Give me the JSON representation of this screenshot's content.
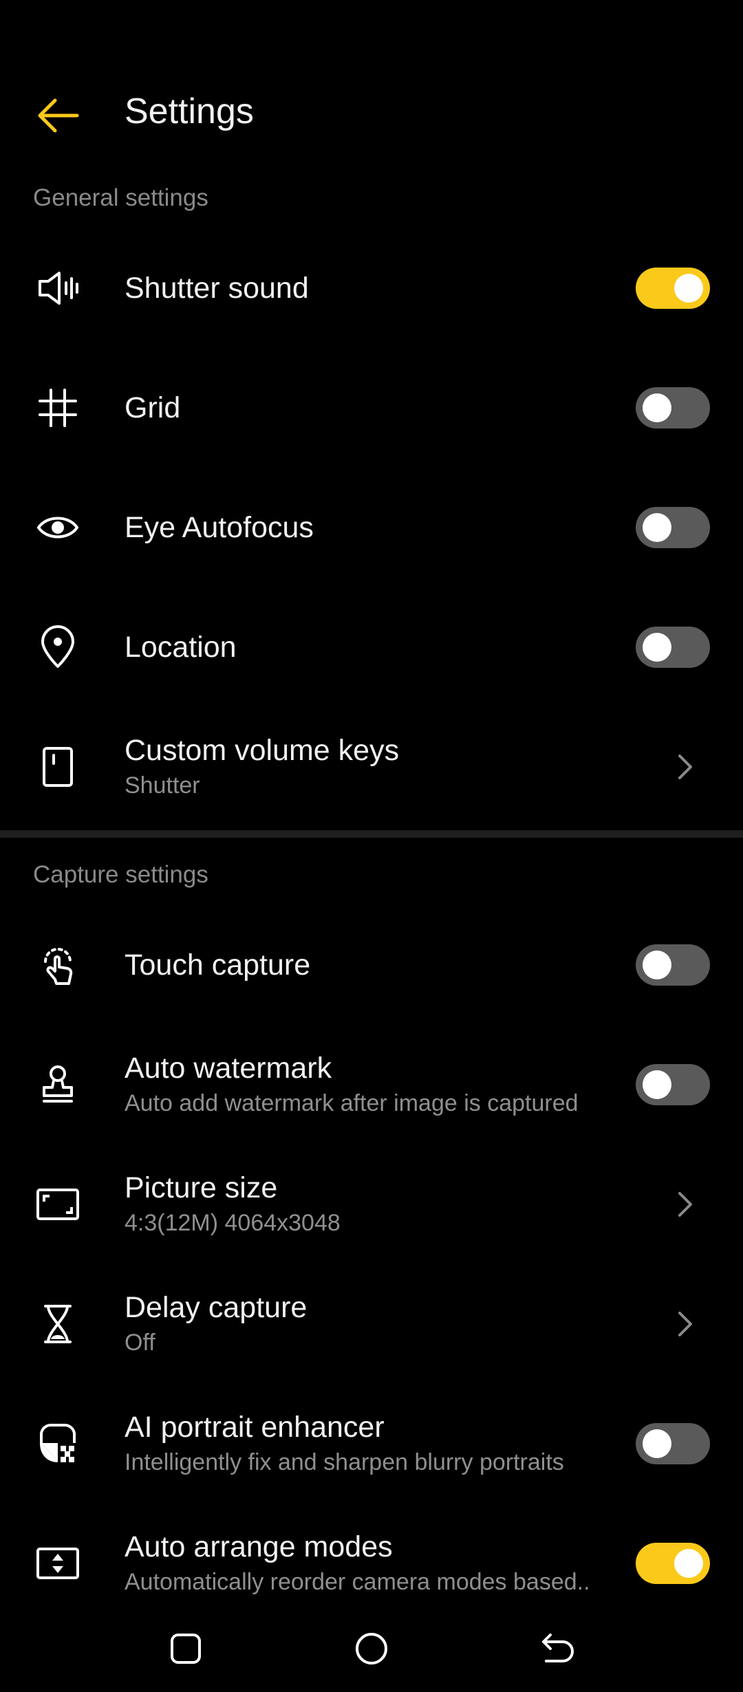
{
  "header": {
    "title": "Settings"
  },
  "sections": {
    "general": "General settings",
    "capture": "Capture settings"
  },
  "general_items": [
    {
      "label": "Shutter sound",
      "icon": "speaker-icon",
      "control": "toggle",
      "on": true
    },
    {
      "label": "Grid",
      "icon": "grid-icon",
      "control": "toggle",
      "on": false
    },
    {
      "label": "Eye Autofocus",
      "icon": "eye-icon",
      "control": "toggle",
      "on": false
    },
    {
      "label": "Location",
      "icon": "location-pin-icon",
      "control": "toggle",
      "on": false
    },
    {
      "label": "Custom volume keys",
      "sub": "Shutter",
      "icon": "phone-volume-key-icon",
      "control": "chevron"
    }
  ],
  "capture_items": [
    {
      "label": "Touch capture",
      "icon": "touch-icon",
      "control": "toggle",
      "on": false
    },
    {
      "label": "Auto watermark",
      "sub": "Auto add watermark after image is captured",
      "icon": "stamp-icon",
      "control": "toggle",
      "on": false
    },
    {
      "label": "Picture size",
      "sub": "4:3(12M) 4064x3048",
      "icon": "aspect-ratio-icon",
      "control": "chevron"
    },
    {
      "label": "Delay capture",
      "sub": "Off",
      "icon": "hourglass-icon",
      "control": "chevron"
    },
    {
      "label": "AI portrait enhancer",
      "sub": "Intelligently fix and sharpen blurry portraits",
      "icon": "portrait-enhance-icon",
      "control": "toggle",
      "on": false
    },
    {
      "label": "Auto arrange modes",
      "sub": "Automatically reorder camera modes based..",
      "icon": "arrange-modes-icon",
      "control": "toggle",
      "on": true
    }
  ],
  "colors": {
    "accent": "#fbc91a",
    "background": "#000000",
    "toggle_off": "#5a5a5a"
  },
  "navbar": [
    "recents-icon",
    "home-icon",
    "back-nav-icon"
  ]
}
